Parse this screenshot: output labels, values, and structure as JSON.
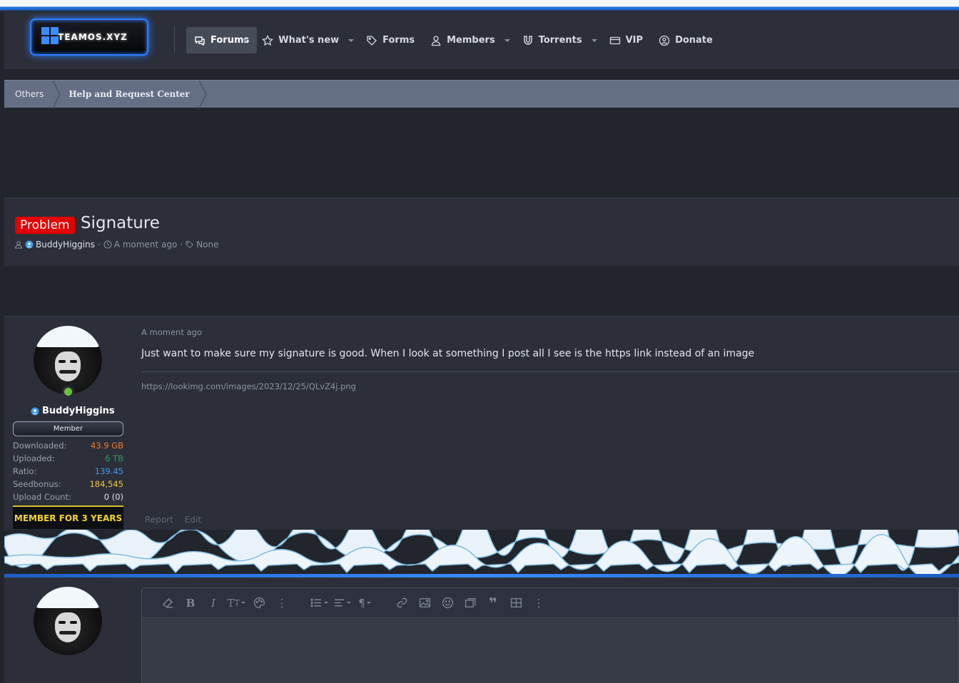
{
  "header": {
    "logo_text": "TEAMOS.XYZ",
    "nav": [
      {
        "label": "Forums",
        "icon": "chat-bubbles-icon",
        "active": true,
        "dropdown": true
      },
      {
        "label": "What's new",
        "icon": "star-icon",
        "active": false,
        "dropdown": true
      },
      {
        "label": "Forms",
        "icon": "tag-icon",
        "active": false,
        "dropdown": false
      },
      {
        "label": "Members",
        "icon": "user-icon",
        "active": false,
        "dropdown": true
      },
      {
        "label": "Torrents",
        "icon": "magnet-icon",
        "active": false,
        "dropdown": true
      },
      {
        "label": "VIP",
        "icon": "credit-card-icon",
        "active": false,
        "dropdown": false
      },
      {
        "label": "Donate",
        "icon": "donate-user-icon",
        "active": false,
        "dropdown": false
      }
    ]
  },
  "breadcrumb": [
    "Others",
    "Help and Request Center"
  ],
  "thread": {
    "prefix": "Problem",
    "title": "Signature",
    "author": "BuddyHiggins",
    "date": "A moment ago",
    "tags": "None"
  },
  "post": {
    "date": "A moment ago",
    "body": "Just want to make sure my signature is good. When I look at something I post all I see is the https link instead of an image",
    "signature": "https://lookimg.com/images/2023/12/25/QLvZ4j.png",
    "actions": [
      "Report",
      "Edit"
    ]
  },
  "user": {
    "name": "BuddyHiggins",
    "rank": "Member",
    "stats": [
      {
        "label": "Downloaded:",
        "value": "43.9 GB",
        "color": "#f07a26"
      },
      {
        "label": "Uploaded:",
        "value": "6 TB",
        "color": "#2f9a62"
      },
      {
        "label": "Ratio:",
        "value": "139.45",
        "color": "#3d9be9"
      },
      {
        "label": "Seedbonus:",
        "value": "184,545",
        "color": "#f4c542"
      },
      {
        "label": "Upload Count:",
        "value": "0 (0)",
        "color": "#e4e6ec"
      }
    ],
    "member_for": "MEMBER FOR 3 YEARS"
  },
  "colors": {
    "prefix_bg": "#e30000",
    "accent_blue": "#1f6fd6"
  },
  "editor_toolbar": [
    "eraser-icon",
    "bold-icon",
    "italic-icon",
    "text-size-icon",
    "palette-icon",
    "more-vertical-icon",
    "list-icon",
    "align-icon",
    "paragraph-icon",
    "link-icon",
    "image-icon",
    "smiley-icon",
    "media-icon",
    "quote-icon",
    "table-icon",
    "more-vertical-icon"
  ]
}
